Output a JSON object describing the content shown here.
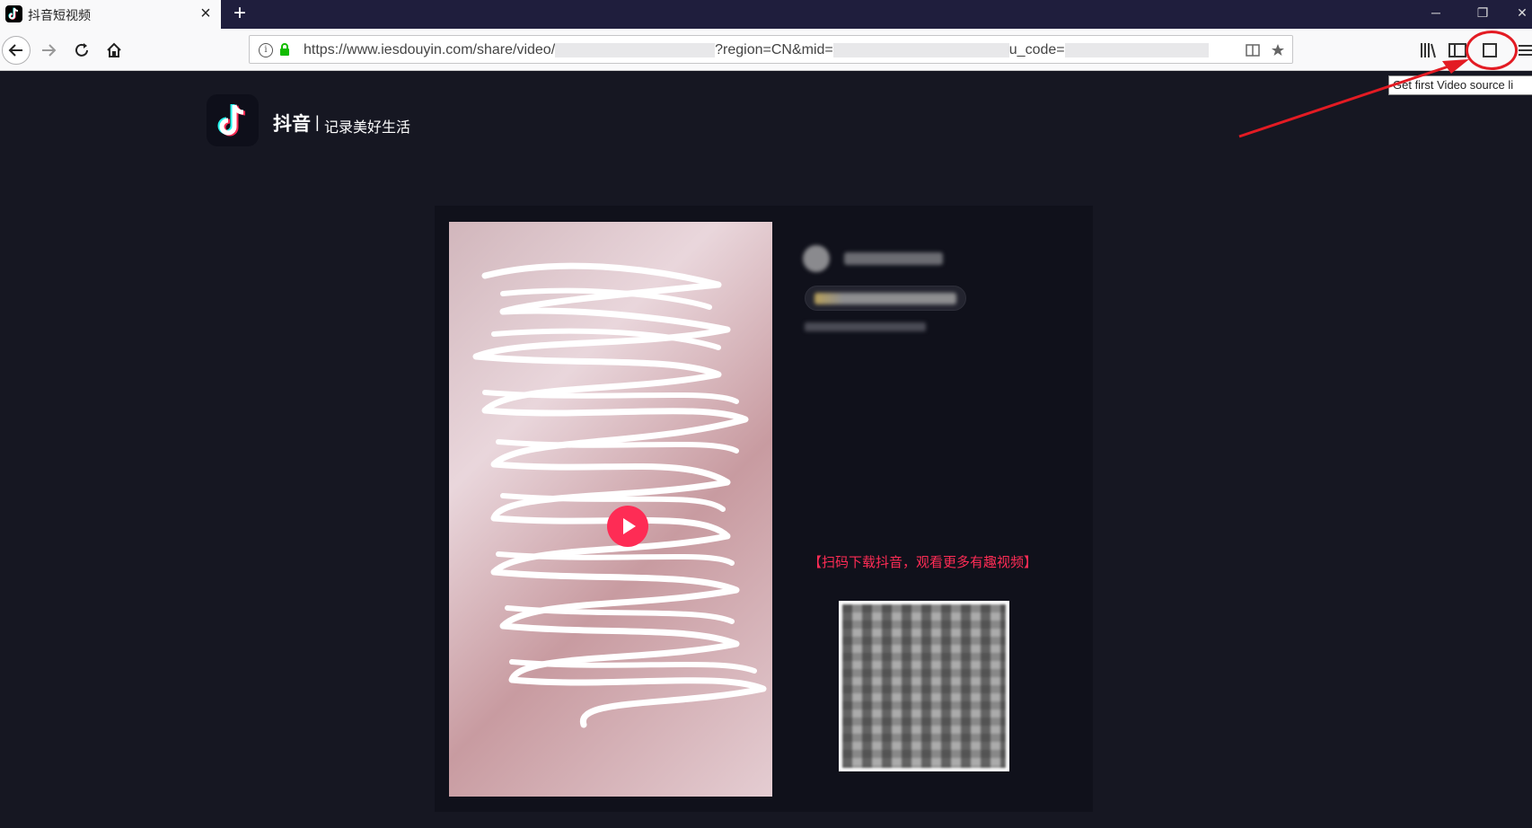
{
  "browser": {
    "tab": {
      "title": "抖音短视频",
      "close_glyph": "×",
      "favicon": "tiktok-icon"
    },
    "new_tab_glyph": "+",
    "window_controls": {
      "minimize": "─",
      "restore": "❐",
      "close": "✕"
    },
    "url": {
      "part1": "https://www.iesdouyin.com/share/video/",
      "part2": "?region=CN&mid=",
      "part3": "u_code="
    },
    "tooltip": "Get first Video source li",
    "accent_color": "#e31b23"
  },
  "page": {
    "brand_name": "抖音",
    "brand_separator": "|",
    "brand_slogan": "记录美好生活",
    "promo_text": "【扫码下载抖音，观看更多有趣视频】",
    "accent_color": "#fe2c55",
    "background_color": "#161722"
  }
}
